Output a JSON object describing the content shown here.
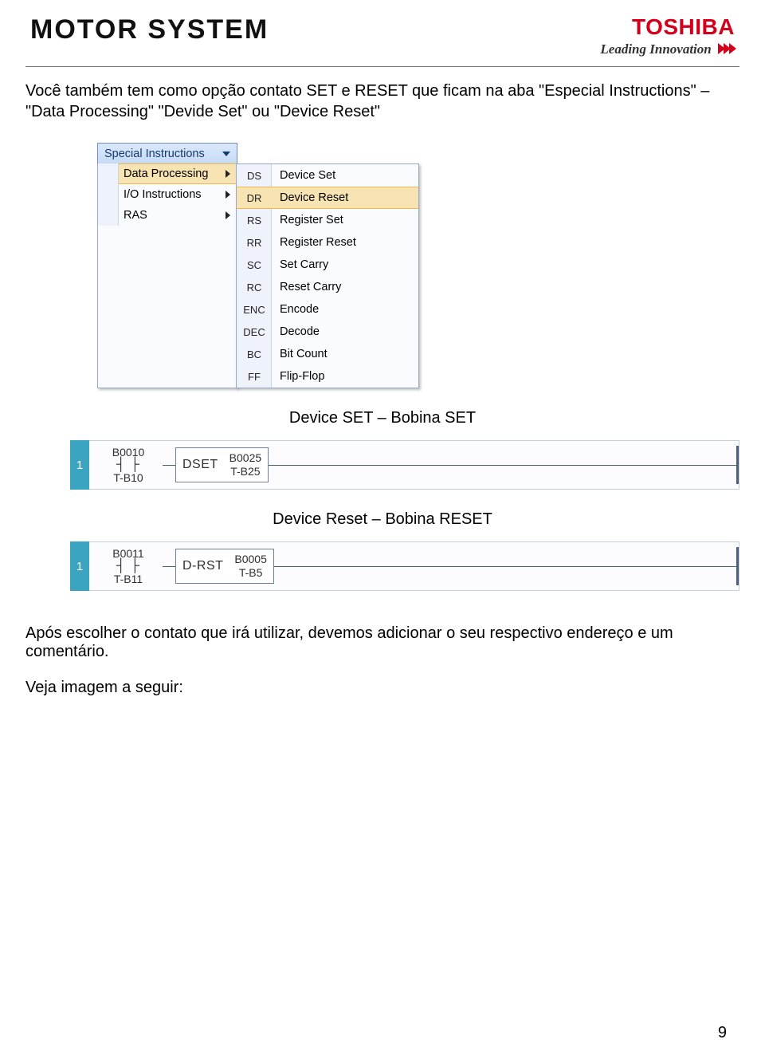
{
  "header": {
    "brand_left": "MOTOR SYSTEM",
    "brand_right": "TOSHIBA",
    "tagline": "Leading Innovation"
  },
  "intro": "Você também tem como opção contato SET e RESET que ficam na aba \"Especial Instructions\" – \"Data Processing\" \"Devide Set\" ou \"Device Reset\"",
  "menu": {
    "button": "Special Instructions",
    "level1": [
      {
        "label": "Data Processing",
        "highlight": true
      },
      {
        "label": "I/O Instructions",
        "highlight": false
      },
      {
        "label": "RAS",
        "highlight": false
      }
    ],
    "level2": [
      {
        "code": "DS",
        "name": "Device Set",
        "highlight": false
      },
      {
        "code": "DR",
        "name": "Device Reset",
        "highlight": true
      },
      {
        "code": "RS",
        "name": "Register Set",
        "highlight": false
      },
      {
        "code": "RR",
        "name": "Register Reset",
        "highlight": false
      },
      {
        "code": "SC",
        "name": "Set Carry",
        "highlight": false
      },
      {
        "code": "RC",
        "name": "Reset Carry",
        "highlight": false
      },
      {
        "code": "ENC",
        "name": "Encode",
        "highlight": false
      },
      {
        "code": "DEC",
        "name": "Decode",
        "highlight": false
      },
      {
        "code": "BC",
        "name": "Bit Count",
        "highlight": false
      },
      {
        "code": "FF",
        "name": "Flip-Flop",
        "highlight": false
      }
    ]
  },
  "caption_set": "Device SET – Bobina SET",
  "ladder_set": {
    "rung": "1",
    "contact_top": "B0010",
    "contact_sym": "┤ ├",
    "contact_bot": "T-B10",
    "op": "DSET",
    "out_top": "B0025",
    "out_bot": "T-B25"
  },
  "caption_reset": "Device Reset – Bobina RESET",
  "ladder_reset": {
    "rung": "1",
    "contact_top": "B0011",
    "contact_sym": "┤ ├",
    "contact_bot": "T-B11",
    "op": "D-RST",
    "out_top": "B0005",
    "out_bot": "T-B5"
  },
  "closing": "Após escolher o contato que irá utilizar, devemos adicionar o seu respectivo endereço e um comentário.",
  "follow": "Veja imagem a seguir:",
  "page_number": "9"
}
